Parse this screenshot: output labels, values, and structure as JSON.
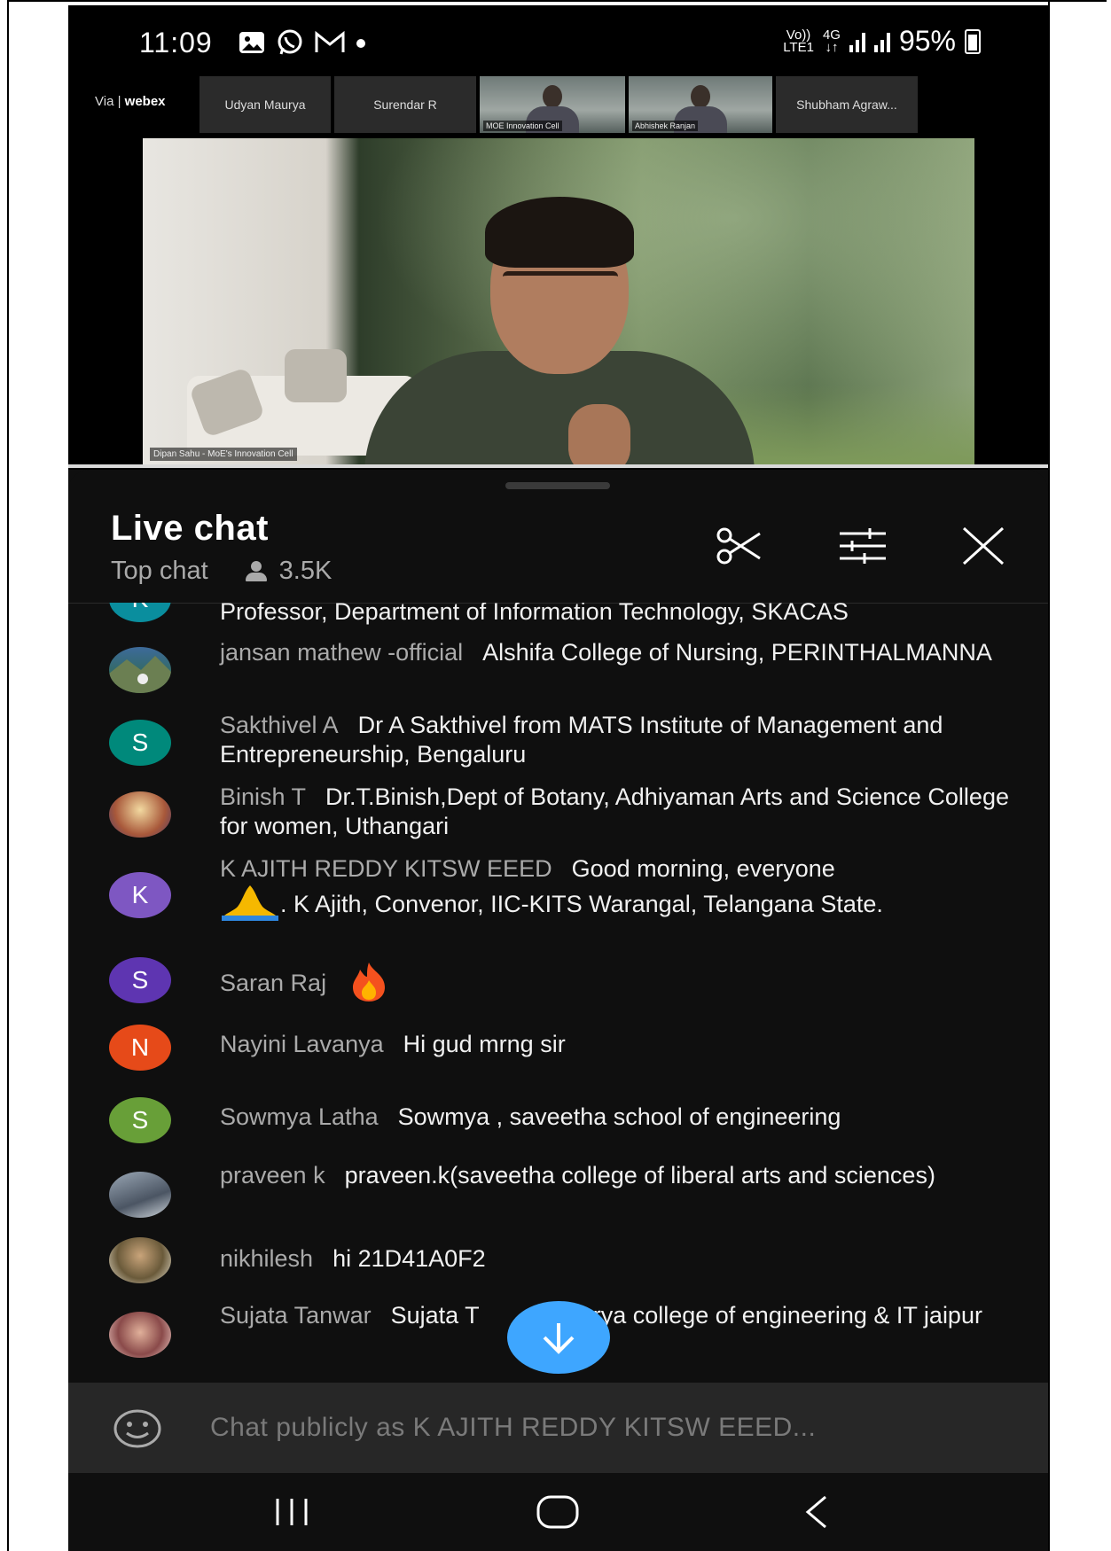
{
  "status_bar": {
    "time": "11:09",
    "network_top": "Vo))",
    "network_bottom": "LTE1",
    "data_type": "4G",
    "battery": "95%",
    "icons": [
      "gallery-icon",
      "whatsapp-icon",
      "gmail-icon",
      "dot-icon",
      "signal-icon",
      "signal-icon",
      "battery-icon"
    ]
  },
  "video": {
    "brand_prefix": "Via",
    "brand": "webex",
    "participants": [
      "Udyan Maurya",
      "Surendar R",
      "MOE Innovation Cell",
      "Abhishek Ranjan",
      "Shubham Agraw..."
    ],
    "speaker_caption": "Dipan Sahu - MoE's Innovation Cell"
  },
  "chat": {
    "title": "Live chat",
    "mode": "Top chat",
    "viewers": "3.5K",
    "header_icons": [
      "scissors-icon",
      "filter-sliders-icon",
      "close-icon"
    ],
    "messages": [
      {
        "author": "",
        "text": "Professor, Department of Information Technology, SKACAS",
        "avatar_letter": "K",
        "avatar_color": "#0a8e9e"
      },
      {
        "author": "jansan mathew -official",
        "text": "Alshifa College of Nursing, PERINTHALMANNA",
        "avatar_letter": "",
        "avatar_color": "#6b8fb8"
      },
      {
        "author": "Sakthivel A",
        "text": "Dr A Sakthivel from MATS Institute of Management and Entrepreneurship, Bengaluru",
        "avatar_letter": "S",
        "avatar_color": "#00897b"
      },
      {
        "author": "Binish T",
        "text": "Dr.T.Binish,Dept of Botany, Adhiyaman Arts and Science College for women, Uthangari",
        "avatar_letter": "",
        "avatar_color": "#c49a5a"
      },
      {
        "author": "K AJITH REDDY KITSW EEED",
        "text": "Good morning, everyone",
        "text2": ". K Ajith, Convenor, IIC-KITS Warangal, Telangana State.",
        "avatar_letter": "K",
        "avatar_color": "#7e57c2"
      },
      {
        "author": "Saran Raj",
        "text": "",
        "avatar_letter": "S",
        "avatar_color": "#5e35b1"
      },
      {
        "author": "Nayini Lavanya",
        "text": "Hi gud mrng sir",
        "avatar_letter": "N",
        "avatar_color": "#e64a19"
      },
      {
        "author": "Sowmya Latha",
        "text": "Sowmya , saveetha school of engineering",
        "avatar_letter": "S",
        "avatar_color": "#689f38"
      },
      {
        "author": "praveen k",
        "text": "praveen.k(saveetha college of liberal arts and sciences)",
        "avatar_letter": "",
        "avatar_color": "#6d7a88"
      },
      {
        "author": "nikhilesh",
        "text": "hi 21D41A0F2",
        "avatar_letter": "",
        "avatar_color": "#8a7a5a"
      },
      {
        "author": "Sujata Tanwar",
        "text": "Sujata T",
        "text_after": "Arya college of engineering & IT jaipur",
        "avatar_letter": "",
        "avatar_color": "#b0706a"
      }
    ],
    "input_placeholder": "Chat publicly as K AJITH REDDY KITSW EEED..."
  },
  "nav": {
    "icons": [
      "recent-apps-icon",
      "home-icon",
      "back-icon"
    ]
  },
  "colors": {
    "background": "#0f0f0f",
    "author_text": "#aaaaaa",
    "accent_blue": "#3ea6ff",
    "input_bar": "#272727"
  }
}
